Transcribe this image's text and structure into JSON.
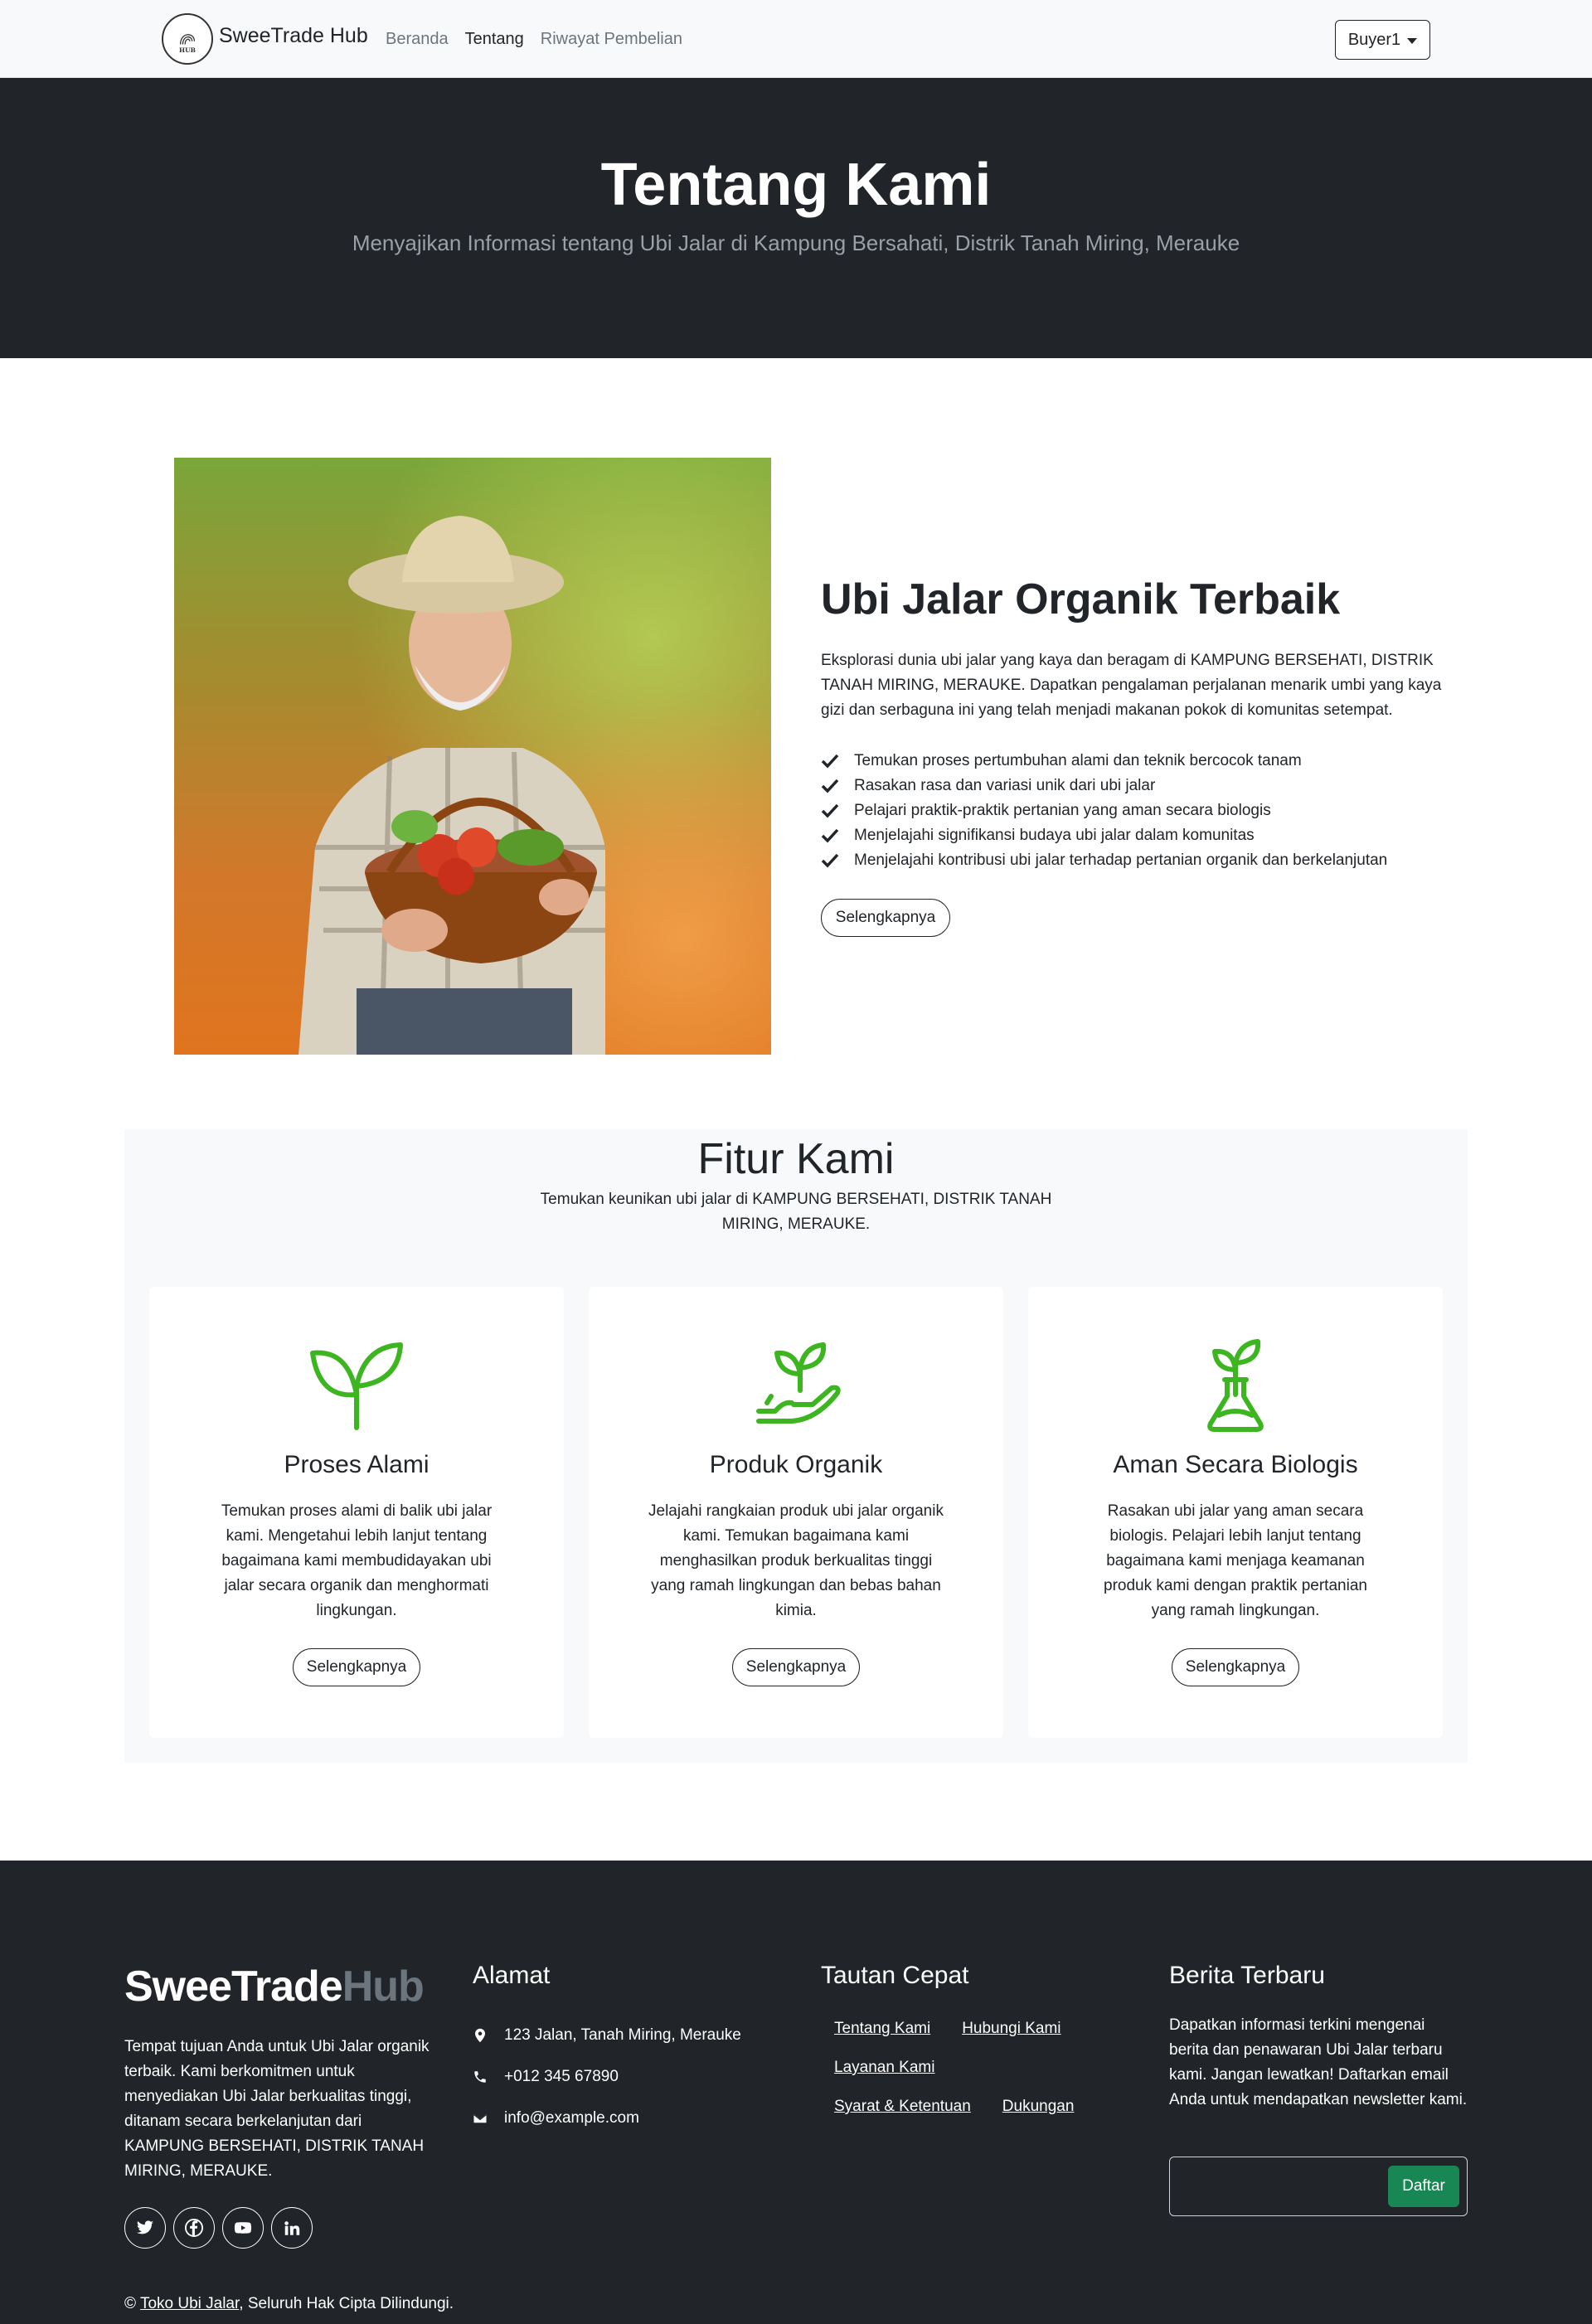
{
  "navbar": {
    "brand": "SweeTrade Hub",
    "links": [
      "Beranda",
      "Tentang",
      "Riwayat Pembelian"
    ],
    "user": "Buyer1"
  },
  "hero": {
    "title": "Tentang Kami",
    "subtitle": "Menyajikan Informasi tentang Ubi Jalar di Kampung Bersahati, Distrik Tanah Miring, Merauke"
  },
  "about": {
    "title": "Ubi Jalar Organik Terbaik",
    "description": "Eksplorasi dunia ubi jalar yang kaya dan beragam di KAMPUNG BERSEHATI, DISTRIK TANAH MIRING, MERAUKE. Dapatkan pengalaman perjalanan menarik umbi yang kaya gizi dan serbaguna ini yang telah menjadi makanan pokok di komunitas setempat.",
    "points": [
      "Temukan proses pertumbuhan alami dan teknik bercocok tanam",
      "Rasakan rasa dan variasi unik dari ubi jalar",
      "Pelajari praktik-praktik pertanian yang aman secara biologis",
      "Menjelajahi signifikansi budaya ubi jalar dalam komunitas",
      "Menjelajahi kontribusi ubi jalar terhadap pertanian organik dan berkelanjutan"
    ],
    "button": "Selengkapnya"
  },
  "features": {
    "title": "Fitur Kami",
    "subtitle": "Temukan keunikan ubi jalar di KAMPUNG BERSEHATI, DISTRIK TANAH MIRING, MERAUKE.",
    "cards": [
      {
        "icon": "sprout-icon",
        "title": "Proses Alami",
        "text": "Temukan proses alami di balik ubi jalar kami. Mengetahui lebih lanjut tentang bagaimana kami membudidayakan ubi jalar secara organik dan menghormati lingkungan.",
        "button": "Selengkapnya"
      },
      {
        "icon": "hand-plant-icon",
        "title": "Produk Organik",
        "text": "Jelajahi rangkaian produk ubi jalar organik kami. Temukan bagaimana kami menghasilkan produk berkualitas tinggi yang ramah lingkungan dan bebas bahan kimia.",
        "button": "Selengkapnya"
      },
      {
        "icon": "flask-plant-icon",
        "title": "Aman Secara Biologis",
        "text": "Rasakan ubi jalar yang aman secara biologis. Pelajari lebih lanjut tentang bagaimana kami menjaga keamanan produk kami dengan praktik pertanian yang ramah lingkungan.",
        "button": "Selengkapnya"
      }
    ]
  },
  "footer": {
    "logo_main": "SweeTrade",
    "logo_accent": "Hub",
    "about": "Tempat tujuan Anda untuk Ubi Jalar organik terbaik. Kami berkomitmen untuk menyediakan Ubi Jalar berkualitas tinggi, ditanam secara berkelanjutan dari KAMPUNG BERSEHATI, DISTRIK TANAH MIRING, MERAUKE.",
    "address_title": "Alamat",
    "address": "123 Jalan, Tanah Miring, Merauke",
    "phone": "+012 345 67890",
    "email": "info@example.com",
    "links_title": "Tautan Cepat",
    "links": [
      "Tentang Kami",
      "Hubungi Kami",
      "Layanan Kami",
      "Syarat & Ketentuan",
      "Dukungan"
    ],
    "news_title": "Berita Terbaru",
    "news_desc": "Dapatkan informasi terkini mengenai berita dan penawaran Ubi Jalar terbaru kami. Jangan lewatkan! Daftarkan email Anda untuk mendapatkan newsletter kami.",
    "news_placeholder": "",
    "news_button": "Daftar",
    "copyright_symbol": "©",
    "copyright_link": "Toko Ubi Jalar",
    "copyright_rest": ", Seluruh Hak Cipta Dilindungi."
  },
  "colors": {
    "dark": "#212529",
    "light": "#f8f9fa",
    "green_icon": "#3cb521",
    "success": "#198754"
  }
}
